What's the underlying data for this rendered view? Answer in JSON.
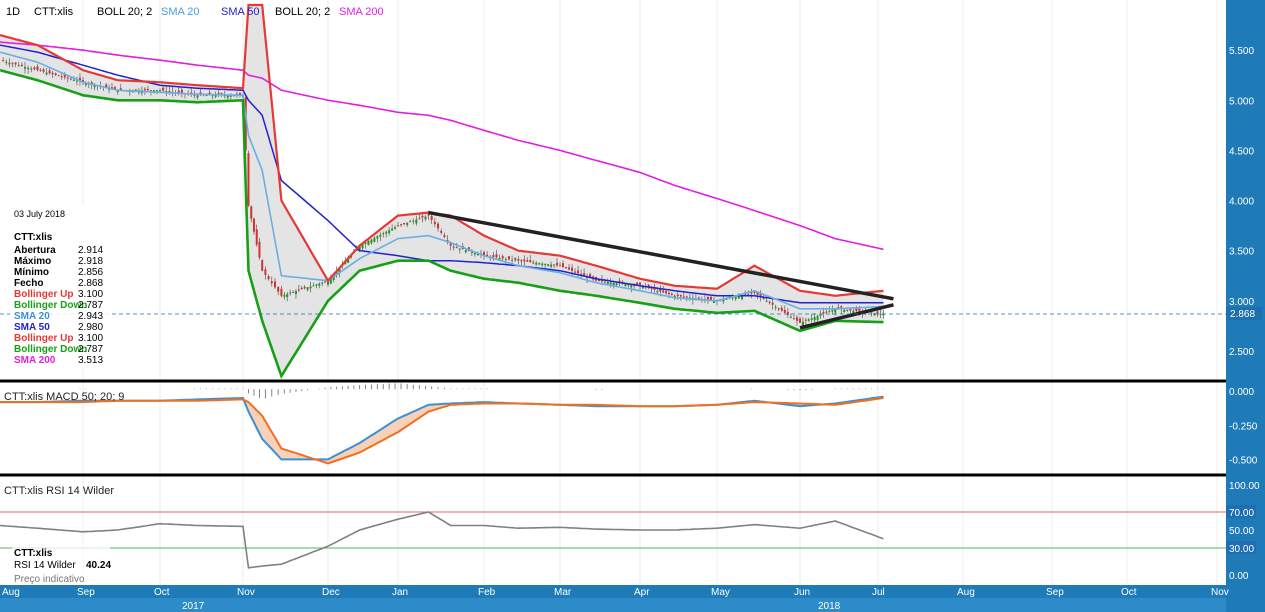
{
  "header": {
    "interval": "1D",
    "symbol": "CTT:xlis",
    "indicators": [
      {
        "label": "BOLL 20; 2",
        "color": "#000000"
      },
      {
        "label": "SMA 20",
        "color": "#4a9ee0"
      },
      {
        "label": "SMA 50",
        "color": "#1f1fd6"
      },
      {
        "label": "BOLL 20; 2",
        "color": "#000000"
      },
      {
        "label": "SMA 200",
        "color": "#e21ee2"
      }
    ]
  },
  "colors": {
    "boll_up": "#e53935",
    "boll_down": "#16a016",
    "sma20": "#6aaee6",
    "sma50": "#2222d0",
    "sma200": "#e21ee2",
    "macd_line": "#3a8fd8",
    "macd_signal": "#f07020",
    "rsi": "#808080",
    "axis_bg": "#1f7ab8",
    "axis_band": "#2d8bc9",
    "price_label_bg": "#1f6fb0"
  },
  "info_box": {
    "date": "03 July 2018",
    "symbol": "CTT:xlis",
    "rows": [
      {
        "label": "Abertura",
        "value": "2.914",
        "color": "#000000"
      },
      {
        "label": "Máximo",
        "value": "2.918",
        "color": "#000000"
      },
      {
        "label": "Mínimo",
        "value": "2.856",
        "color": "#000000"
      },
      {
        "label": "Fecho",
        "value": "2.868",
        "color": "#000000"
      },
      {
        "label": "Bollinger Up",
        "value": "3.100",
        "color": "#e53935"
      },
      {
        "label": "Bollinger Down",
        "value": "2.787",
        "color": "#16a016"
      },
      {
        "label": "SMA 20",
        "value": "2.943",
        "color": "#3a8fd8"
      },
      {
        "label": "SMA 50",
        "value": "2.980",
        "color": "#2222d0"
      },
      {
        "label": "Bollinger Up",
        "value": "3.100",
        "color": "#e53935"
      },
      {
        "label": "Bollinger Down",
        "value": "2.787",
        "color": "#16a016"
      },
      {
        "label": "SMA 200",
        "value": "3.513",
        "color": "#e21ee2"
      }
    ]
  },
  "last_price_label": "2.868",
  "macd_panel": {
    "title": "CTT:xlis  MACD 50; 20; 9"
  },
  "rsi_panel": {
    "title": "CTT:xlis  RSI 14 Wilder",
    "info_symbol": "CTT:xlis",
    "info_label": "RSI 14 Wilder",
    "info_value": "40.24",
    "note": "Preço indicativo",
    "level_high": "70.00",
    "level_low": "30.00"
  },
  "chart_data": {
    "type": "line",
    "title": "CTT:xlis",
    "x_months": [
      "Aug",
      "Sep",
      "Oct",
      "Nov",
      "Dec",
      "Jan",
      "Feb",
      "Mar",
      "Apr",
      "May",
      "Jun",
      "Jul",
      "Aug",
      "Sep",
      "Oct",
      "Nov"
    ],
    "x_years": [
      "2017",
      "2018"
    ],
    "price_axis": {
      "ticks": [
        "2.500",
        "3.000",
        "3.500",
        "4.000",
        "4.500",
        "5.000",
        "5.500"
      ],
      "ylim": [
        2.2,
        6.0
      ]
    },
    "macd_axis": {
      "ticks": [
        "0.000",
        "-0.250",
        "-0.500"
      ],
      "ylim": [
        -0.6,
        0.06
      ]
    },
    "rsi_axis": {
      "ticks": [
        "0.00",
        "30.00",
        "50.00",
        "70.00",
        "100.00"
      ],
      "ylim": [
        0,
        100
      ]
    },
    "last_close": 2.868,
    "x": [
      "Aug 1",
      "Aug 15",
      "Sep 1",
      "Sep 15",
      "Oct 1",
      "Oct 15",
      "Nov 1",
      "Nov 3",
      "Nov 8",
      "Nov 15",
      "Dec 1",
      "Dec 15",
      "Jan 1",
      "Jan 12",
      "Jan 20",
      "Feb 1",
      "Feb 15",
      "Mar 1",
      "Mar 15",
      "Apr 1",
      "Apr 15",
      "May 1",
      "May 15",
      "Jun 1",
      "Jun 15",
      "Jul 3"
    ],
    "series": [
      {
        "key": "close",
        "values": [
          5.4,
          5.3,
          5.18,
          5.1,
          5.1,
          5.05,
          5.05,
          3.95,
          3.3,
          3.05,
          3.2,
          3.55,
          3.75,
          3.85,
          3.55,
          3.45,
          3.4,
          3.35,
          3.2,
          3.15,
          3.05,
          3.0,
          3.08,
          2.78,
          2.92,
          2.868
        ]
      },
      {
        "key": "boll_up",
        "values": [
          5.65,
          5.55,
          5.3,
          5.2,
          5.18,
          5.15,
          5.12,
          5.95,
          5.95,
          4.0,
          3.2,
          3.55,
          3.85,
          3.88,
          3.85,
          3.65,
          3.5,
          3.45,
          3.35,
          3.22,
          3.15,
          3.12,
          3.35,
          3.1,
          3.05,
          3.1
        ]
      },
      {
        "key": "boll_down",
        "values": [
          5.3,
          5.2,
          5.05,
          5.0,
          5.0,
          4.98,
          5.0,
          3.3,
          2.8,
          2.25,
          3.0,
          3.3,
          3.4,
          3.4,
          3.3,
          3.22,
          3.18,
          3.1,
          3.05,
          2.98,
          2.92,
          2.88,
          2.9,
          2.7,
          2.8,
          2.787
        ]
      },
      {
        "key": "sma20",
        "values": [
          5.48,
          5.38,
          5.18,
          5.1,
          5.08,
          5.06,
          5.05,
          4.65,
          4.3,
          3.25,
          3.2,
          3.42,
          3.62,
          3.65,
          3.58,
          3.45,
          3.35,
          3.28,
          3.18,
          3.1,
          3.03,
          3.0,
          3.1,
          2.92,
          2.92,
          2.943
        ]
      },
      {
        "key": "sma50",
        "values": [
          5.55,
          5.48,
          5.35,
          5.25,
          5.15,
          5.12,
          5.1,
          5.0,
          4.85,
          4.2,
          3.8,
          3.5,
          3.45,
          3.4,
          3.4,
          3.38,
          3.35,
          3.3,
          3.22,
          3.15,
          3.1,
          3.05,
          3.05,
          2.98,
          2.98,
          2.98
        ]
      },
      {
        "key": "sma200",
        "values": [
          5.58,
          5.55,
          5.5,
          5.45,
          5.4,
          5.35,
          5.3,
          5.25,
          5.22,
          5.1,
          5.0,
          4.95,
          4.88,
          4.85,
          4.8,
          4.7,
          4.6,
          4.5,
          4.4,
          4.28,
          4.15,
          4.02,
          3.9,
          3.75,
          3.62,
          3.513
        ]
      },
      {
        "key": "macd",
        "values": [
          -0.08,
          -0.08,
          -0.07,
          -0.07,
          -0.07,
          -0.06,
          -0.05,
          -0.15,
          -0.35,
          -0.5,
          -0.5,
          -0.38,
          -0.2,
          -0.1,
          -0.09,
          -0.08,
          -0.09,
          -0.1,
          -0.11,
          -0.11,
          -0.11,
          -0.1,
          -0.07,
          -0.11,
          -0.09,
          -0.04
        ]
      },
      {
        "key": "macd_signal",
        "values": [
          -0.08,
          -0.08,
          -0.08,
          -0.07,
          -0.07,
          -0.07,
          -0.06,
          -0.08,
          -0.18,
          -0.42,
          -0.53,
          -0.45,
          -0.3,
          -0.15,
          -0.1,
          -0.09,
          -0.09,
          -0.1,
          -0.1,
          -0.11,
          -0.11,
          -0.1,
          -0.08,
          -0.09,
          -0.1,
          -0.05
        ]
      },
      {
        "key": "rsi",
        "values": [
          55,
          52,
          48,
          50,
          57,
          55,
          54,
          8,
          10,
          12,
          32,
          50,
          62,
          70,
          55,
          55,
          52,
          53,
          51,
          50,
          50,
          52,
          56,
          52,
          60,
          40.24
        ]
      }
    ],
    "trendlines": [
      {
        "from": {
          "x": "Jan 12",
          "y": 3.88
        },
        "to": {
          "x": "Jul 3",
          "y": 3.02
        }
      },
      {
        "from": {
          "x": "Jun 1",
          "y": 2.73
        },
        "to": {
          "x": "Jul 3",
          "y": 2.96
        }
      }
    ]
  }
}
